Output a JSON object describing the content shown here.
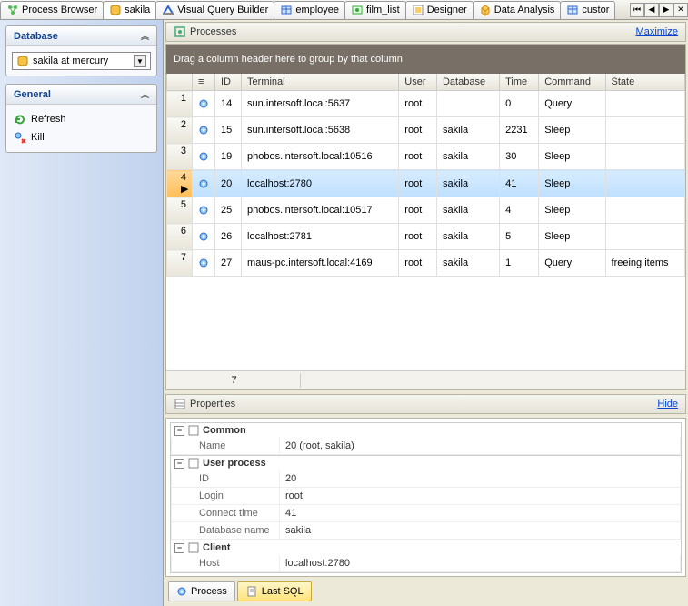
{
  "tabs": [
    {
      "label": "Process Browser",
      "icon": "process"
    },
    {
      "label": "sakila",
      "icon": "db",
      "active": true
    },
    {
      "label": "Visual Query Builder",
      "icon": "query"
    },
    {
      "label": "employee",
      "icon": "table"
    },
    {
      "label": "film_list",
      "icon": "view"
    },
    {
      "label": "Designer",
      "icon": "designer"
    },
    {
      "label": "Data Analysis",
      "icon": "cube"
    },
    {
      "label": "custor",
      "icon": "table"
    }
  ],
  "sidebar": {
    "database_header": "Database",
    "database_value": "sakila at mercury",
    "general_header": "General",
    "items": [
      {
        "label": "Refresh",
        "icon": "refresh"
      },
      {
        "label": "Kill",
        "icon": "kill"
      }
    ]
  },
  "processes": {
    "title": "Processes",
    "maximize": "Maximize",
    "group_hint": "Drag a column header here to group by that column",
    "columns": [
      "ID",
      "Terminal",
      "User",
      "Database",
      "Time",
      "Command",
      "State"
    ],
    "rows": [
      {
        "n": 1,
        "id": "14",
        "terminal": "sun.intersoft.local:5637",
        "user": "root",
        "db": "",
        "time": "0",
        "cmd": "Query",
        "state": ""
      },
      {
        "n": 2,
        "id": "15",
        "terminal": "sun.intersoft.local:5638",
        "user": "root",
        "db": "sakila",
        "time": "2231",
        "cmd": "Sleep",
        "state": ""
      },
      {
        "n": 3,
        "id": "19",
        "terminal": "phobos.intersoft.local:10516",
        "user": "root",
        "db": "sakila",
        "time": "30",
        "cmd": "Sleep",
        "state": ""
      },
      {
        "n": 4,
        "id": "20",
        "terminal": "localhost:2780",
        "user": "root",
        "db": "sakila",
        "time": "41",
        "cmd": "Sleep",
        "state": "",
        "selected": true
      },
      {
        "n": 5,
        "id": "25",
        "terminal": "phobos.intersoft.local:10517",
        "user": "root",
        "db": "sakila",
        "time": "4",
        "cmd": "Sleep",
        "state": ""
      },
      {
        "n": 6,
        "id": "26",
        "terminal": "localhost:2781",
        "user": "root",
        "db": "sakila",
        "time": "5",
        "cmd": "Sleep",
        "state": ""
      },
      {
        "n": 7,
        "id": "27",
        "terminal": "maus-pc.intersoft.local:4169",
        "user": "root",
        "db": "sakila",
        "time": "1",
        "cmd": "Query",
        "state": "freeing items"
      }
    ],
    "footer_count": "7"
  },
  "properties": {
    "title": "Properties",
    "hide": "Hide",
    "sections": [
      {
        "name": "Common",
        "rows": [
          {
            "label": "Name",
            "value": "20 (root, sakila)"
          }
        ]
      },
      {
        "name": "User process",
        "rows": [
          {
            "label": "ID",
            "value": "20"
          },
          {
            "label": "Login",
            "value": "root"
          },
          {
            "label": "Connect time",
            "value": "41"
          },
          {
            "label": "Database name",
            "value": "sakila"
          }
        ]
      },
      {
        "name": "Client",
        "rows": [
          {
            "label": "Host",
            "value": "localhost:2780"
          }
        ]
      }
    ]
  },
  "bottom_tabs": [
    {
      "label": "Process",
      "active": false
    },
    {
      "label": "Last SQL",
      "active": true
    }
  ]
}
